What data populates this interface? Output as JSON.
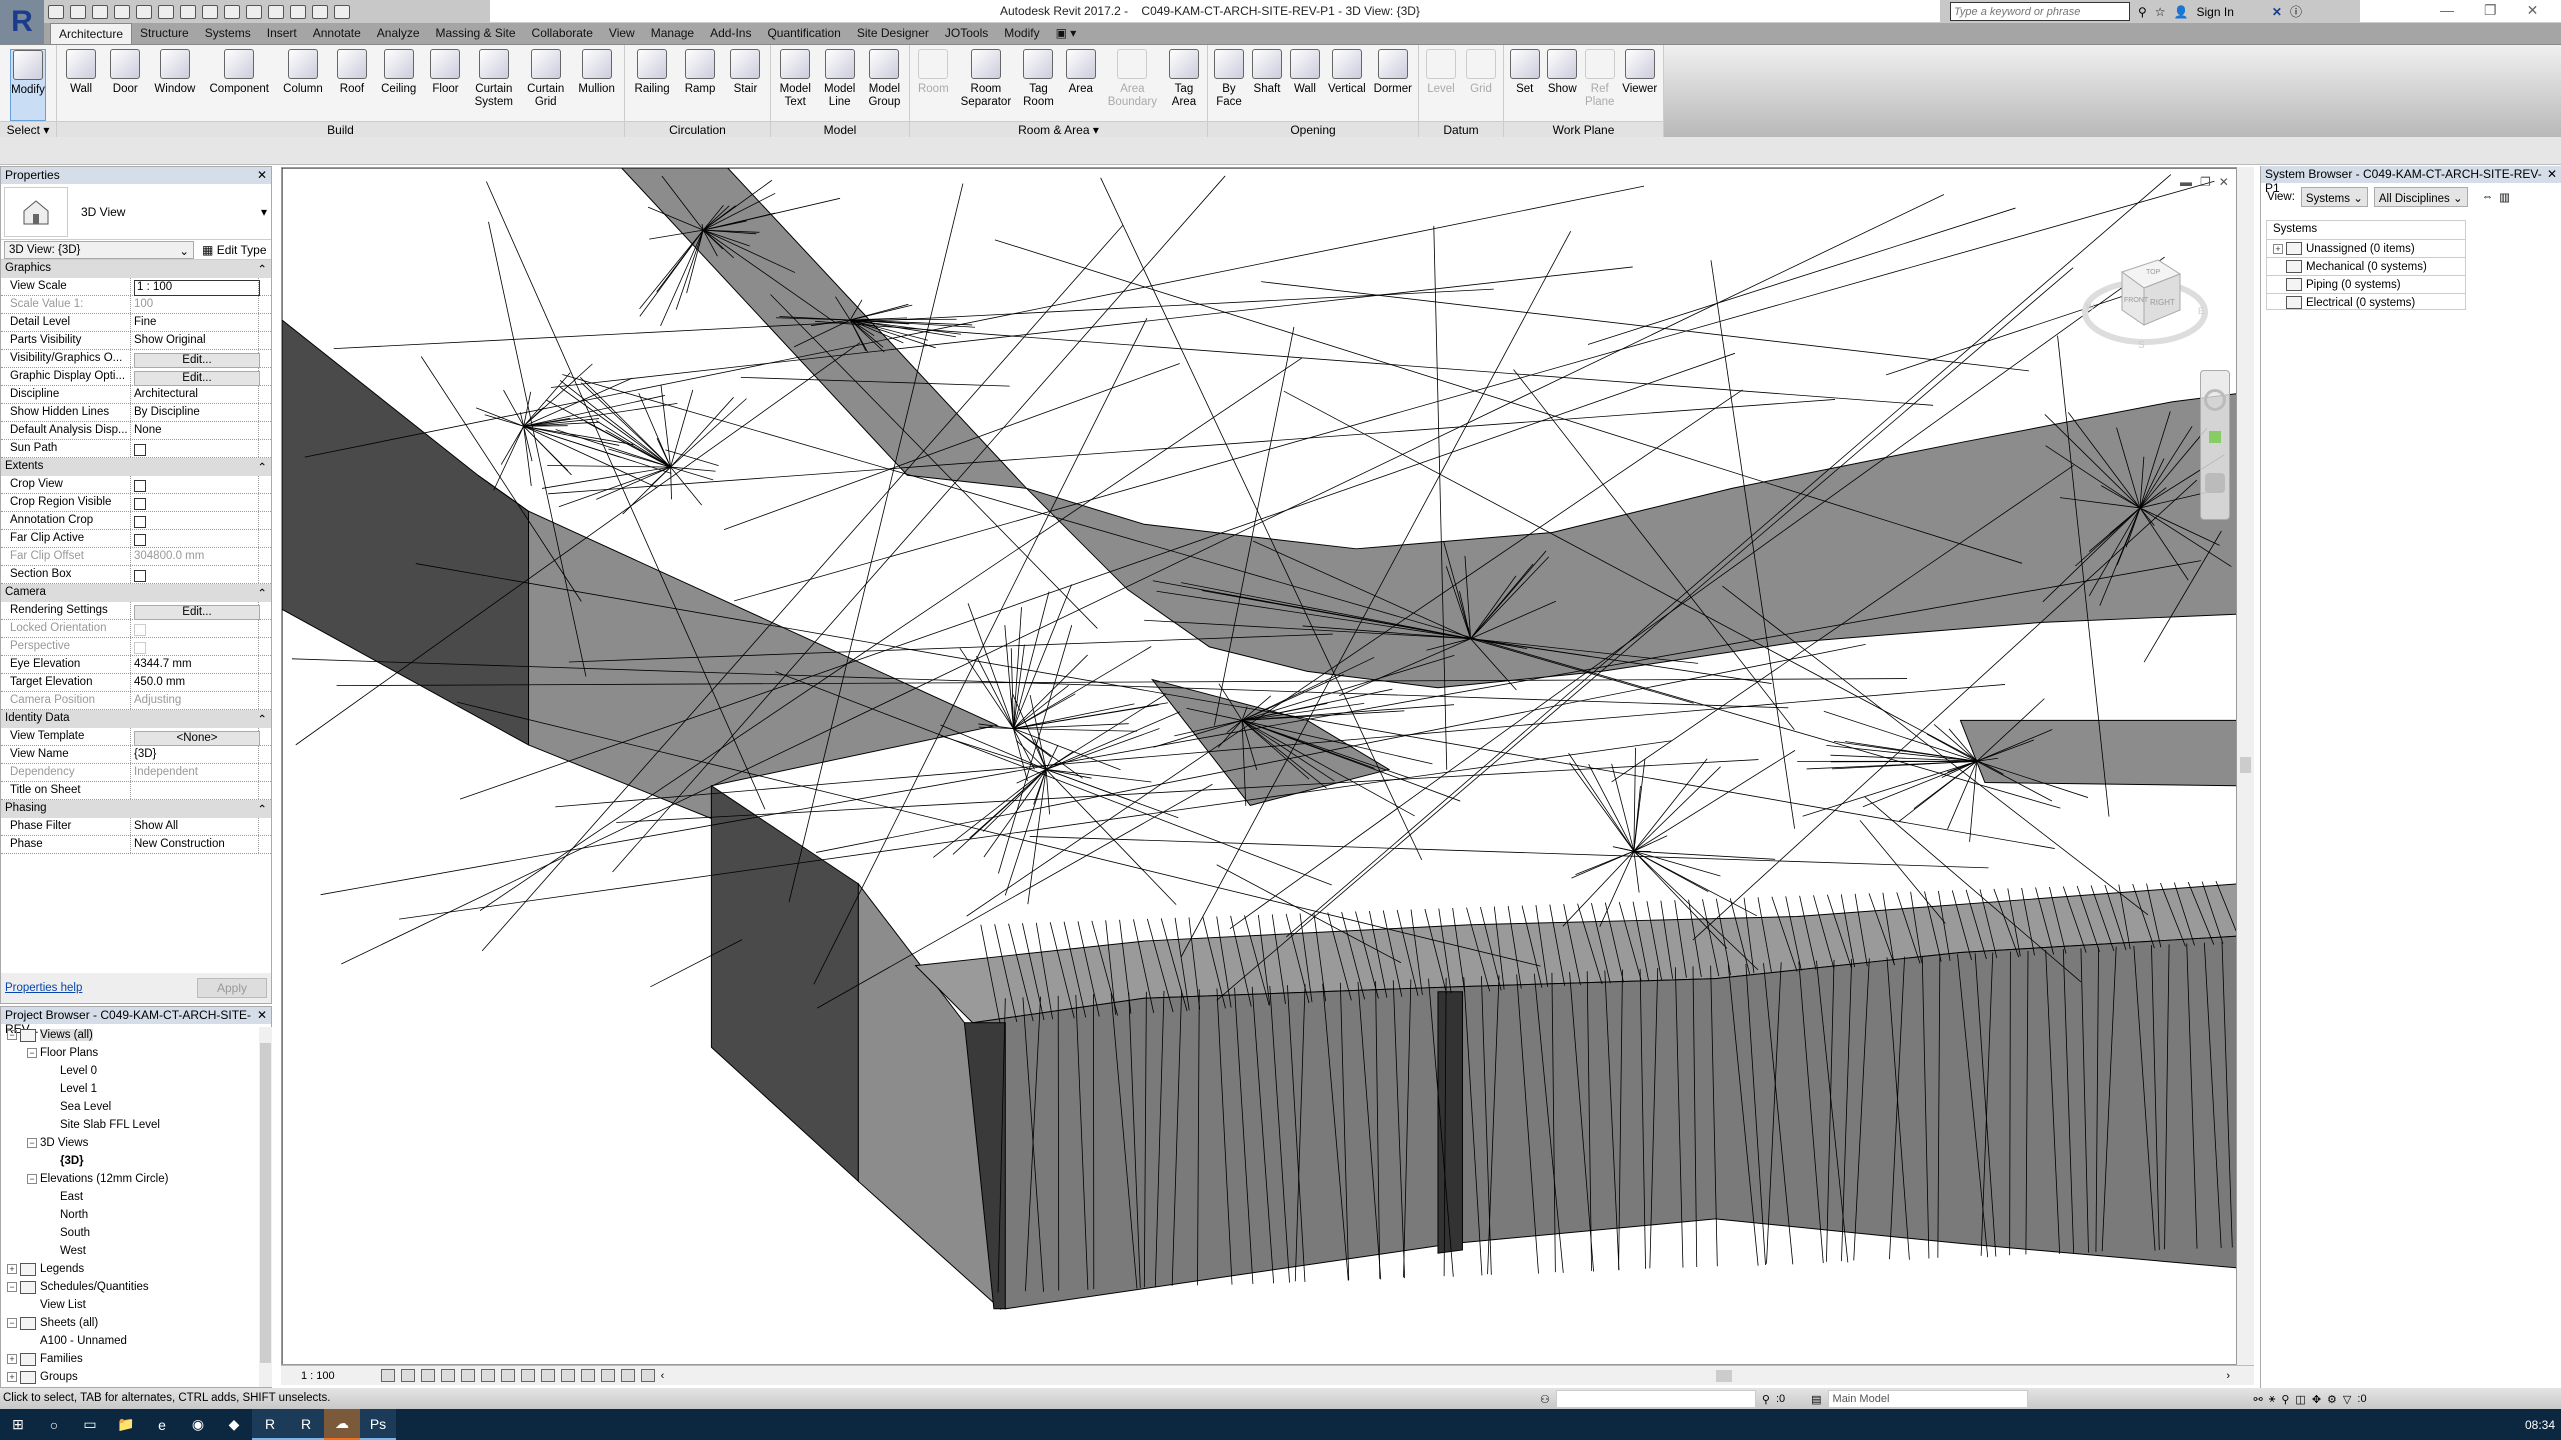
{
  "app": {
    "title": "Autodesk Revit 2017.2 -    C049-KAM-CT-ARCH-SITE-REV-P1 - 3D View: {3D}",
    "logo": "R",
    "search_placeholder": "Type a keyword or phrase",
    "sign_in": "Sign In"
  },
  "tabs": [
    {
      "label": "Architecture",
      "active": true
    },
    {
      "label": "Structure"
    },
    {
      "label": "Systems"
    },
    {
      "label": "Insert"
    },
    {
      "label": "Annotate"
    },
    {
      "label": "Analyze"
    },
    {
      "label": "Massing & Site"
    },
    {
      "label": "Collaborate"
    },
    {
      "label": "View"
    },
    {
      "label": "Manage"
    },
    {
      "label": "Add-Ins"
    },
    {
      "label": "Quantification"
    },
    {
      "label": "Site Designer"
    },
    {
      "label": "JOTools"
    },
    {
      "label": "Modify"
    },
    {
      "label": "▣ ▾"
    }
  ],
  "ribbon": [
    {
      "label": "Select ▾",
      "buttons": [
        {
          "label": "Modify",
          "icon": "cursor-icon",
          "selected": true
        }
      ]
    },
    {
      "label": "Build",
      "buttons": [
        {
          "label": "Wall",
          "icon": "wall-icon"
        },
        {
          "label": "Door",
          "icon": "door-icon"
        },
        {
          "label": "Window",
          "icon": "window-icon"
        },
        {
          "label": "Component",
          "icon": "component-icon"
        },
        {
          "label": "Column",
          "icon": "column-icon"
        },
        {
          "label": "Roof",
          "icon": "roof-icon"
        },
        {
          "label": "Ceiling",
          "icon": "ceiling-icon"
        },
        {
          "label": "Floor",
          "icon": "floor-icon"
        },
        {
          "label": "Curtain System",
          "icon": "curtain-system-icon"
        },
        {
          "label": "Curtain Grid",
          "icon": "curtain-grid-icon"
        },
        {
          "label": "Mullion",
          "icon": "mullion-icon"
        }
      ]
    },
    {
      "label": "Circulation",
      "buttons": [
        {
          "label": "Railing",
          "icon": "railing-icon"
        },
        {
          "label": "Ramp",
          "icon": "ramp-icon"
        },
        {
          "label": "Stair",
          "icon": "stair-icon"
        }
      ]
    },
    {
      "label": "Model",
      "buttons": [
        {
          "label": "Model Text",
          "icon": "model-text-icon"
        },
        {
          "label": "Model Line",
          "icon": "model-line-icon"
        },
        {
          "label": "Model Group",
          "icon": "model-group-icon"
        }
      ]
    },
    {
      "label": "Room & Area ▾",
      "buttons": [
        {
          "label": "Room",
          "icon": "room-icon",
          "disabled": true
        },
        {
          "label": "Room Separator",
          "icon": "room-separator-icon"
        },
        {
          "label": "Tag Room",
          "icon": "tag-room-icon"
        },
        {
          "label": "Area",
          "icon": "area-icon"
        },
        {
          "label": "Area Boundary",
          "icon": "area-boundary-icon",
          "disabled": true
        },
        {
          "label": "Tag Area",
          "icon": "tag-area-icon"
        }
      ]
    },
    {
      "label": "Opening",
      "buttons": [
        {
          "label": "By Face",
          "icon": "by-face-icon"
        },
        {
          "label": "Shaft",
          "icon": "shaft-icon"
        },
        {
          "label": "Wall",
          "icon": "wall-opening-icon"
        },
        {
          "label": "Vertical",
          "icon": "vertical-icon"
        },
        {
          "label": "Dormer",
          "icon": "dormer-icon"
        }
      ]
    },
    {
      "label": "Datum",
      "buttons": [
        {
          "label": "Level",
          "icon": "level-icon",
          "disabled": true
        },
        {
          "label": "Grid",
          "icon": "grid-icon",
          "disabled": true
        }
      ]
    },
    {
      "label": "Work Plane",
      "buttons": [
        {
          "label": "Set",
          "icon": "set-icon"
        },
        {
          "label": "Show",
          "icon": "show-icon"
        },
        {
          "label": "Ref Plane",
          "icon": "ref-plane-icon",
          "disabled": true
        },
        {
          "label": "Viewer",
          "icon": "viewer-icon"
        }
      ]
    }
  ],
  "properties": {
    "title": "Properties",
    "type_name": "3D View",
    "instance": "3D View: {3D}",
    "edit_type": "Edit Type",
    "sections": [
      {
        "title": "Graphics",
        "rows": [
          {
            "label": "View Scale",
            "value": "1 : 100",
            "type": "input"
          },
          {
            "label": "Scale Value    1:",
            "value": "100",
            "disabled": true
          },
          {
            "label": "Detail Level",
            "value": "Fine"
          },
          {
            "label": "Parts Visibility",
            "value": "Show Original"
          },
          {
            "label": "Visibility/Graphics O...",
            "value": "Edit...",
            "type": "button"
          },
          {
            "label": "Graphic Display Opti...",
            "value": "Edit...",
            "type": "button"
          },
          {
            "label": "Discipline",
            "value": "Architectural"
          },
          {
            "label": "Show Hidden Lines",
            "value": "By Discipline"
          },
          {
            "label": "Default Analysis Disp...",
            "value": "None"
          },
          {
            "label": "Sun Path",
            "type": "checkbox"
          }
        ]
      },
      {
        "title": "Extents",
        "rows": [
          {
            "label": "Crop View",
            "type": "checkbox"
          },
          {
            "label": "Crop Region Visible",
            "type": "checkbox"
          },
          {
            "label": "Annotation Crop",
            "type": "checkbox"
          },
          {
            "label": "Far Clip Active",
            "type": "checkbox"
          },
          {
            "label": "Far Clip Offset",
            "value": "304800.0 mm",
            "disabled": true
          },
          {
            "label": "Section Box",
            "type": "checkbox"
          }
        ]
      },
      {
        "title": "Camera",
        "rows": [
          {
            "label": "Rendering Settings",
            "value": "Edit...",
            "type": "button"
          },
          {
            "label": "Locked Orientation",
            "type": "checkbox",
            "disabled": true
          },
          {
            "label": "Perspective",
            "type": "checkbox",
            "disabled": true
          },
          {
            "label": "Eye Elevation",
            "value": "4344.7 mm"
          },
          {
            "label": "Target Elevation",
            "value": "450.0 mm"
          },
          {
            "label": "Camera Position",
            "value": "Adjusting",
            "disabled": true
          }
        ]
      },
      {
        "title": "Identity Data",
        "rows": [
          {
            "label": "View Template",
            "value": "<None>",
            "type": "button"
          },
          {
            "label": "View Name",
            "value": "{3D}"
          },
          {
            "label": "Dependency",
            "value": "Independent",
            "disabled": true
          },
          {
            "label": "Title on Sheet",
            "value": ""
          }
        ]
      },
      {
        "title": "Phasing",
        "rows": [
          {
            "label": "Phase Filter",
            "value": "Show All"
          },
          {
            "label": "Phase",
            "value": "New Construction"
          }
        ]
      }
    ],
    "help": "Properties help",
    "apply": "Apply"
  },
  "project_browser": {
    "title": "Project Browser - C049-KAM-CT-ARCH-SITE-REV...",
    "items": [
      {
        "label": "Views (all)",
        "level": 0,
        "exp": "−",
        "icon": "views-icon"
      },
      {
        "label": "Floor Plans",
        "level": 1,
        "exp": "−"
      },
      {
        "label": "Level 0",
        "level": 2
      },
      {
        "label": "Level 1",
        "level": 2
      },
      {
        "label": "Sea Level",
        "level": 2
      },
      {
        "label": "Site Slab FFL Level",
        "level": 2
      },
      {
        "label": "3D Views",
        "level": 1,
        "exp": "−"
      },
      {
        "label": "{3D}",
        "level": 2,
        "bold": true
      },
      {
        "label": "Elevations (12mm Circle)",
        "level": 1,
        "exp": "−"
      },
      {
        "label": "East",
        "level": 2
      },
      {
        "label": "North",
        "level": 2
      },
      {
        "label": "South",
        "level": 2
      },
      {
        "label": "West",
        "level": 2
      },
      {
        "label": "Legends",
        "level": 0,
        "exp": "+",
        "icon": "legends-icon"
      },
      {
        "label": "Schedules/Quantities",
        "level": 0,
        "exp": "−",
        "icon": "schedules-icon"
      },
      {
        "label": "View List",
        "level": 1
      },
      {
        "label": "Sheets (all)",
        "level": 0,
        "exp": "−",
        "icon": "sheets-icon"
      },
      {
        "label": "A100 - Unnamed",
        "level": 1
      },
      {
        "label": "Families",
        "level": 0,
        "exp": "+",
        "icon": "families-icon"
      },
      {
        "label": "Groups",
        "level": 0,
        "exp": "+",
        "icon": "groups-icon"
      }
    ]
  },
  "viewport": {
    "scale": "1 : 100",
    "viewcube": {
      "top": "TOP",
      "front": "FRONT",
      "right": "RIGHT",
      "w": "W",
      "e": "E",
      "s": "S"
    }
  },
  "system_browser": {
    "title": "System Browser - C049-KAM-CT-ARCH-SITE-REV-P1",
    "view_label": "View:",
    "view_value": "Systems",
    "discipline": "All Disciplines",
    "column": "Systems",
    "items": [
      {
        "label": "Unassigned (0 items)",
        "exp": "+"
      },
      {
        "label": "Mechanical (0 systems)"
      },
      {
        "label": "Piping (0 systems)"
      },
      {
        "label": "Electrical (0 systems)"
      }
    ]
  },
  "status": {
    "message": "Click to select, TAB for alternates, CTRL adds, SHIFT unselects.",
    "count": ":0",
    "model": "Main Model",
    "filter_count": ":0"
  },
  "taskbar": {
    "clock": "08:34",
    "apps": [
      "windows-start-icon",
      "cortana-icon",
      "task-view-icon",
      "file-explorer-icon",
      "edge-icon",
      "chrome-icon",
      "app-icon",
      "revit-viewer-icon",
      "revit-icon",
      "onedrive-icon",
      "photoshop-icon"
    ]
  },
  "colors": {
    "ribbon_tabbar": "#a5a5a5",
    "selected_button": "#c9def5",
    "taskbar": "#0c2841",
    "surface_gray": "#8c8c8c",
    "wall_dark": "#4a4a4a"
  }
}
